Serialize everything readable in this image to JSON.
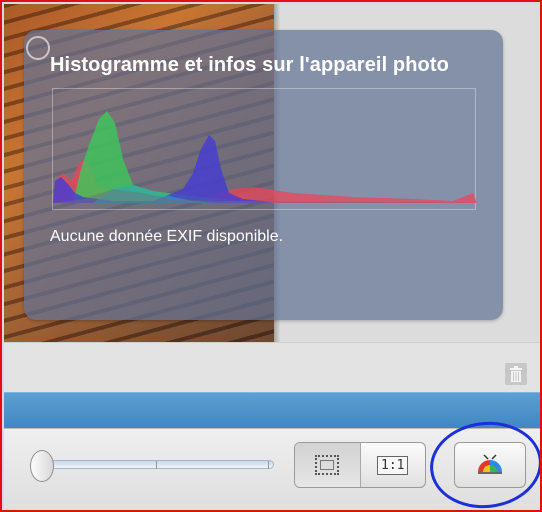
{
  "overlay": {
    "title": "Histogramme et infos sur l'appareil photo",
    "exif_message": "Aucune donnée EXIF disponible."
  },
  "toolbar": {
    "zoom_slider_level": 0.0,
    "fit_button_icon": "fit-to-window-icon",
    "actual_size_label": "1:1",
    "color_button_icon": "color-adjust-icon"
  },
  "icons": {
    "info": "info-icon",
    "trash": "trash-icon"
  },
  "colors": {
    "frame_border": "#e01010",
    "highlight_ring": "#1d2fd6",
    "blue_bar": "#4a90cc",
    "overlay": "#6473966b"
  }
}
